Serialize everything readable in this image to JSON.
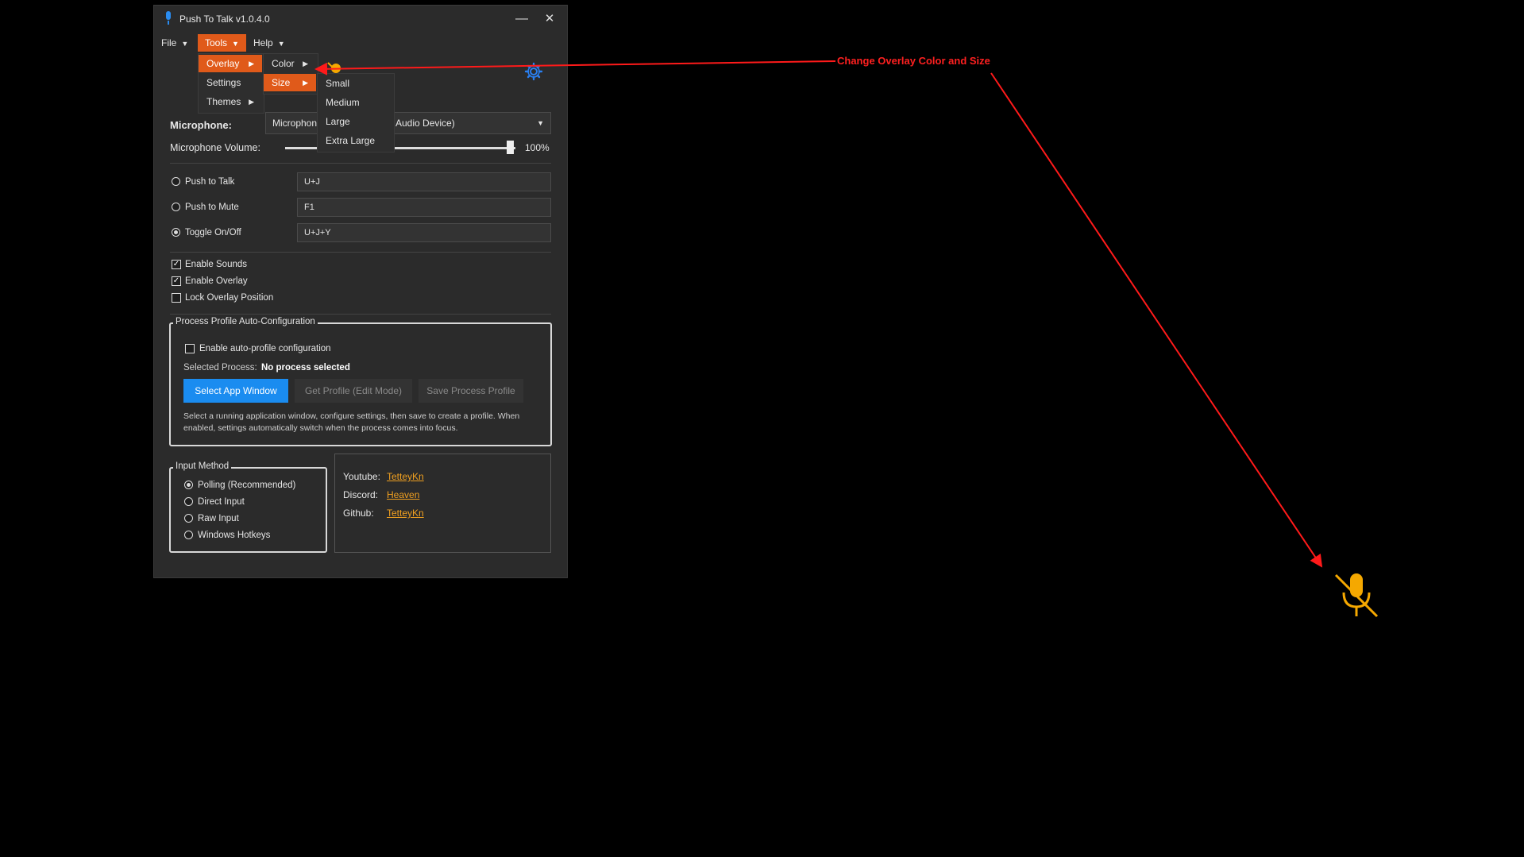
{
  "window": {
    "title": "Push To Talk v1.0.4.0"
  },
  "menubar": {
    "file": "File",
    "tools": "Tools",
    "help": "Help"
  },
  "tools_menu": {
    "items": [
      {
        "label": "Overlay"
      },
      {
        "label": "Settings"
      },
      {
        "label": "Themes"
      }
    ]
  },
  "overlay_menu": {
    "items": [
      {
        "label": "Color"
      },
      {
        "label": "Size"
      }
    ]
  },
  "size_menu": {
    "items": [
      {
        "label": "Small"
      },
      {
        "label": "Medium"
      },
      {
        "label": "Large"
      },
      {
        "label": "Extra Large"
      }
    ]
  },
  "microphone": {
    "label": "Microphone:",
    "device_left": "Microphone",
    "device_right": "Audio Device)",
    "volume_label": "Microphone Volume:",
    "volume_value": 100,
    "volume_text": "100%"
  },
  "modes": [
    {
      "label": "Push to Talk",
      "hotkey": "U+J",
      "selected": false
    },
    {
      "label": "Push to Mute",
      "hotkey": "F1",
      "selected": false
    },
    {
      "label": "Toggle On/Off",
      "hotkey": "U+J+Y",
      "selected": true
    }
  ],
  "options": [
    {
      "label": "Enable Sounds",
      "checked": true
    },
    {
      "label": "Enable Overlay",
      "checked": true
    },
    {
      "label": "Lock Overlay Position",
      "checked": false
    }
  ],
  "profile": {
    "legend": "Process Profile Auto-Configuration",
    "enable_label": "Enable auto-profile configuration",
    "selected_label": "Selected Process:",
    "selected_value": "No process selected",
    "select_btn": "Select App Window",
    "get_btn": "Get Profile (Edit Mode)",
    "save_btn": "Save Process Profile",
    "help_line1": "Select a running application window, configure settings, then save to create a profile. When",
    "help_line2": "enabled, settings automatically switch when the process comes into focus."
  },
  "input_method": {
    "legend": "Input Method",
    "options": [
      {
        "label": "Polling (Recommended)",
        "selected": true
      },
      {
        "label": "Direct Input",
        "selected": false
      },
      {
        "label": "Raw Input",
        "selected": false
      },
      {
        "label": "Windows Hotkeys",
        "selected": false
      }
    ]
  },
  "links": [
    {
      "label": "Youtube:",
      "value": "TetteyKn"
    },
    {
      "label": "Discord:",
      "value": "Heaven"
    },
    {
      "label": "Github:",
      "value": "TetteyKn"
    }
  ],
  "annotation": {
    "text": "Change Overlay Color and Size",
    "color": "#ff2020"
  },
  "colors": {
    "accent": "#e05a1a",
    "primary_button": "#1a8cf0",
    "link": "#f0a020",
    "overlay_icon": "#f5a800"
  }
}
